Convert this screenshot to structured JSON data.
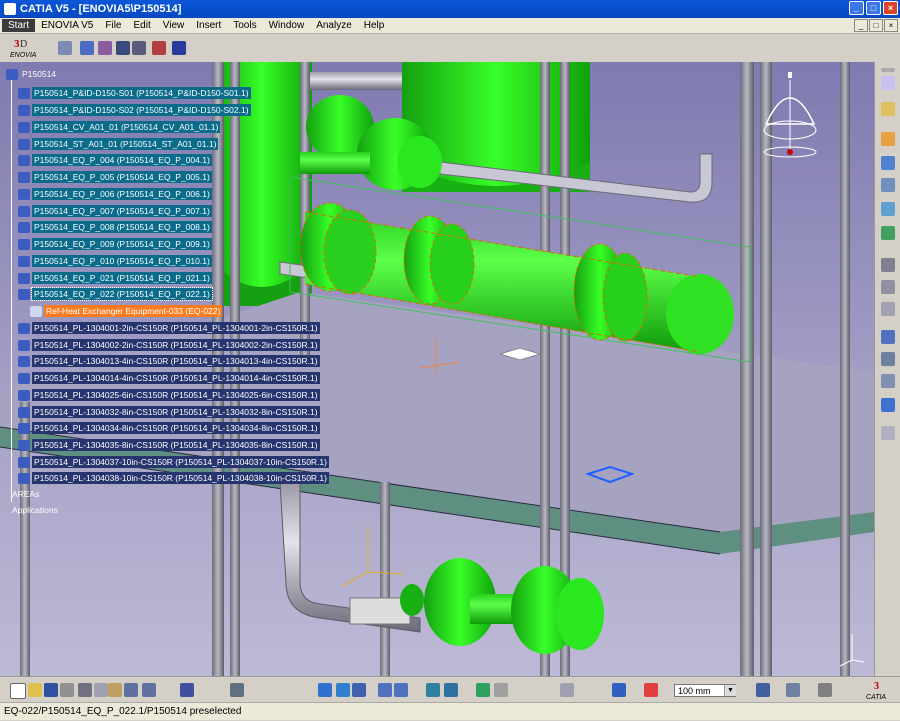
{
  "window": {
    "title": "CATIA V5 - [ENOVIA5\\P150514]",
    "buttons": [
      "_",
      "□",
      "×"
    ]
  },
  "menu": {
    "items": [
      "Start",
      "ENOVIA V5",
      "File",
      "Edit",
      "View",
      "Insert",
      "Tools",
      "Window",
      "Analyze",
      "Help"
    ]
  },
  "brand": {
    "logo_text": "ENOVIA",
    "catia_text": "CATIA"
  },
  "tree": {
    "root": "P150514",
    "nodes": [
      "P150514_P&ID-D150-S01 (P150514_P&ID-D150-S01.1)",
      "P150514_P&ID-D150-S02 (P150514_P&ID-D150-S02.1)",
      "P150514_CV_A01_01 (P150514_CV_A01_01.1)",
      "P150514_ST_A01_01 (P150514_ST_A01_01.1)",
      "P150514_EQ_P_004 (P150514_EQ_P_004.1)",
      "P150514_EQ_P_005 (P150514_EQ_P_005.1)",
      "P150514_EQ_P_006 (P150514_EQ_P_006.1)",
      "P150514_EQ_P_007 (P150514_EQ_P_007.1)",
      "P150514_EQ_P_008 (P150514_EQ_P_008.1)",
      "P150514_EQ_P_009 (P150514_EQ_P_009.1)",
      "P150514_EQ_P_010 (P150514_EQ_P_010.1)",
      "P150514_EQ_P_021 (P150514_EQ_P_021.1)",
      "P150514_EQ_P_022 (P150514_EQ_P_022.1)",
      "Ref-Heat Exchanger Equipment-033 (EQ-022)",
      "P150514_PL-1304001-2in-CS150R (P150514_PL-1304001-2in-CS150R.1)",
      "P150514_PL-1304002-2in-CS150R (P150514_PL-1304002-2in-CS150R.1)",
      "P150514_PL-1304013-4in-CS150R (P150514_PL-1304013-4in-CS150R.1)",
      "P150514_PL-1304014-4in-CS150R (P150514_PL-1304014-4in-CS150R.1)",
      "P150514_PL-1304025-6in-CS150R (P150514_PL-1304025-6in-CS150R.1)",
      "P150514_PL-1304032-8in-CS150R (P150514_PL-1304032-8in-CS150R.1)",
      "P150514_PL-1304034-8in-CS150R (P150514_PL-1304034-8in-CS150R.1)",
      "P150514_PL-1304035-8in-CS150R (P150514_PL-1304035-8in-CS150R.1)",
      "P150514_PL-1304037-10in-CS150R (P150514_PL-1304037-10in-CS150R.1)",
      "P150514_PL-1304038-10in-CS150R (P150514_PL-1304038-10in-CS150R.1)",
      "AREAs",
      "Applications"
    ]
  },
  "bottom_toolbar": {
    "unit_value": "100 mm"
  },
  "status": {
    "text": "EQ-022/P150514_EQ_P_022.1/P150514 preselected"
  },
  "colors": {
    "equipment_green": "#22e01a",
    "selection_orange": "#ff7b1f",
    "tree_highlight": "#0a6b8a",
    "tree_line": "#26356e",
    "background_top": "#7f7ab0"
  }
}
